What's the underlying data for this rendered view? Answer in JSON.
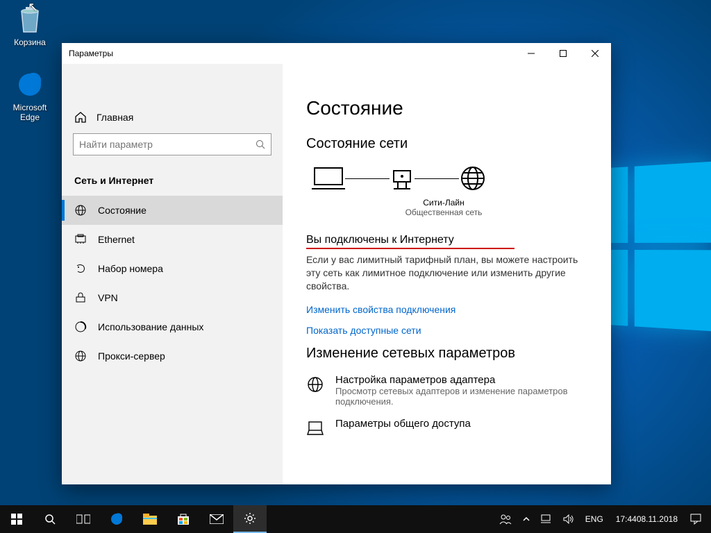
{
  "desktop": {
    "recycle_label": "Корзина",
    "edge_label": "Microsoft Edge"
  },
  "window": {
    "title": "Параметры",
    "home": "Главная",
    "search_placeholder": "Найти параметр",
    "section": "Сеть и Интернет",
    "nav": [
      {
        "label": "Состояние"
      },
      {
        "label": "Ethernet"
      },
      {
        "label": "Набор номера"
      },
      {
        "label": "VPN"
      },
      {
        "label": "Использование данных"
      },
      {
        "label": "Прокси-сервер"
      }
    ]
  },
  "main": {
    "h1": "Состояние",
    "h2_status": "Состояние сети",
    "diagram": {
      "name": "Сити-Лайн",
      "type": "Общественная сеть"
    },
    "connected_header": "Вы подключены к Интернету",
    "connected_body": "Если у вас лимитный тарифный план, вы можете настроить эту сеть как лимитное подключение или изменить другие свойства.",
    "link_change": "Изменить свойства подключения",
    "link_show": "Показать доступные сети",
    "h2_change": "Изменение сетевых параметров",
    "opt_adapter_title": "Настройка параметров адаптера",
    "opt_adapter_desc": "Просмотр сетевых адаптеров и изменение параметров подключения.",
    "opt_share_title": "Параметры общего доступа"
  },
  "tray": {
    "lang": "ENG",
    "time": "17:44",
    "date": "08.11.2018"
  }
}
